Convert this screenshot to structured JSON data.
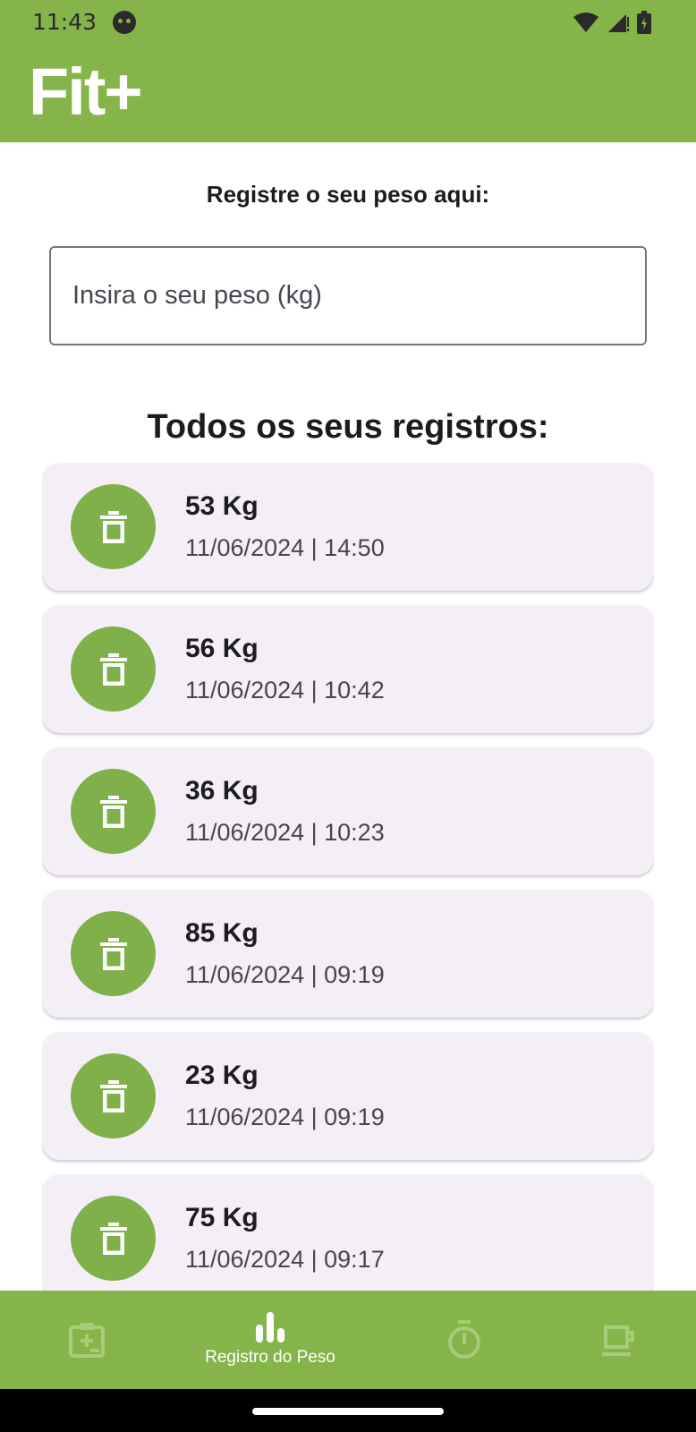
{
  "status_bar": {
    "time": "11:43"
  },
  "app": {
    "title": "Fit+"
  },
  "form": {
    "label": "Registre o seu peso aqui:",
    "input_placeholder": "Insira o seu peso (kg)",
    "input_value": ""
  },
  "records": {
    "title": "Todos os seus registros:",
    "items": [
      {
        "weight": "53 Kg",
        "datetime": "11/06/2024 | 14:50"
      },
      {
        "weight": "56 Kg",
        "datetime": "11/06/2024 | 10:42"
      },
      {
        "weight": "36 Kg",
        "datetime": "11/06/2024 | 10:23"
      },
      {
        "weight": "85 Kg",
        "datetime": "11/06/2024 | 09:19"
      },
      {
        "weight": "23 Kg",
        "datetime": "11/06/2024 | 09:19"
      },
      {
        "weight": "75 Kg",
        "datetime": "11/06/2024 | 09:17"
      }
    ]
  },
  "bottom_nav": {
    "items": [
      {
        "icon": "medical-clipboard-icon",
        "label": "",
        "active": false
      },
      {
        "icon": "bar-chart-icon",
        "label": "Registro do Peso",
        "active": true
      },
      {
        "icon": "timer-icon",
        "label": "",
        "active": false
      },
      {
        "icon": "cup-icon",
        "label": "",
        "active": false
      }
    ]
  },
  "colors": {
    "primary": "#85b54a",
    "card_background": "#f4eff7",
    "delete_button": "#7fb04a",
    "nav_inactive_icon": "#a8cc7a"
  }
}
